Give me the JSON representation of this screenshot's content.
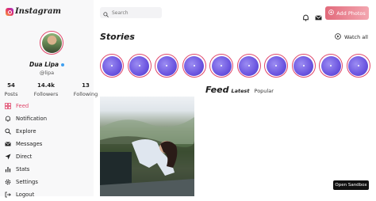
{
  "app": {
    "name": "Instagram"
  },
  "profile": {
    "name": "Dua Lipa",
    "handle": "@lipa",
    "stats": [
      {
        "value": "54",
        "label": "Posts"
      },
      {
        "value": "14.4k",
        "label": "Followers"
      },
      {
        "value": "13",
        "label": "Following"
      }
    ]
  },
  "menu": [
    {
      "label": "Feed",
      "icon": "grid-icon",
      "active": true
    },
    {
      "label": "Notification",
      "icon": "bell-icon"
    },
    {
      "label": "Explore",
      "icon": "search-icon"
    },
    {
      "label": "Messages",
      "icon": "mail-icon"
    },
    {
      "label": "Direct",
      "icon": "send-icon"
    },
    {
      "label": "Stats",
      "icon": "stats-icon"
    },
    {
      "label": "Settings",
      "icon": "gear-icon"
    },
    {
      "label": "Logout",
      "icon": "logout-icon"
    }
  ],
  "search": {
    "placeholder": "Search"
  },
  "header": {
    "add_photos": "Add Photos"
  },
  "stories": {
    "title": "Stories",
    "watch_all": "Watch all",
    "count": 10
  },
  "feed": {
    "title": "Feed",
    "tabs": [
      "Latest",
      "Popular"
    ]
  },
  "sandbox": {
    "label": "Open Sandbox"
  },
  "colors": {
    "accent": "#e0476b",
    "story": "#6b55e0",
    "button": "#e26a7b"
  }
}
